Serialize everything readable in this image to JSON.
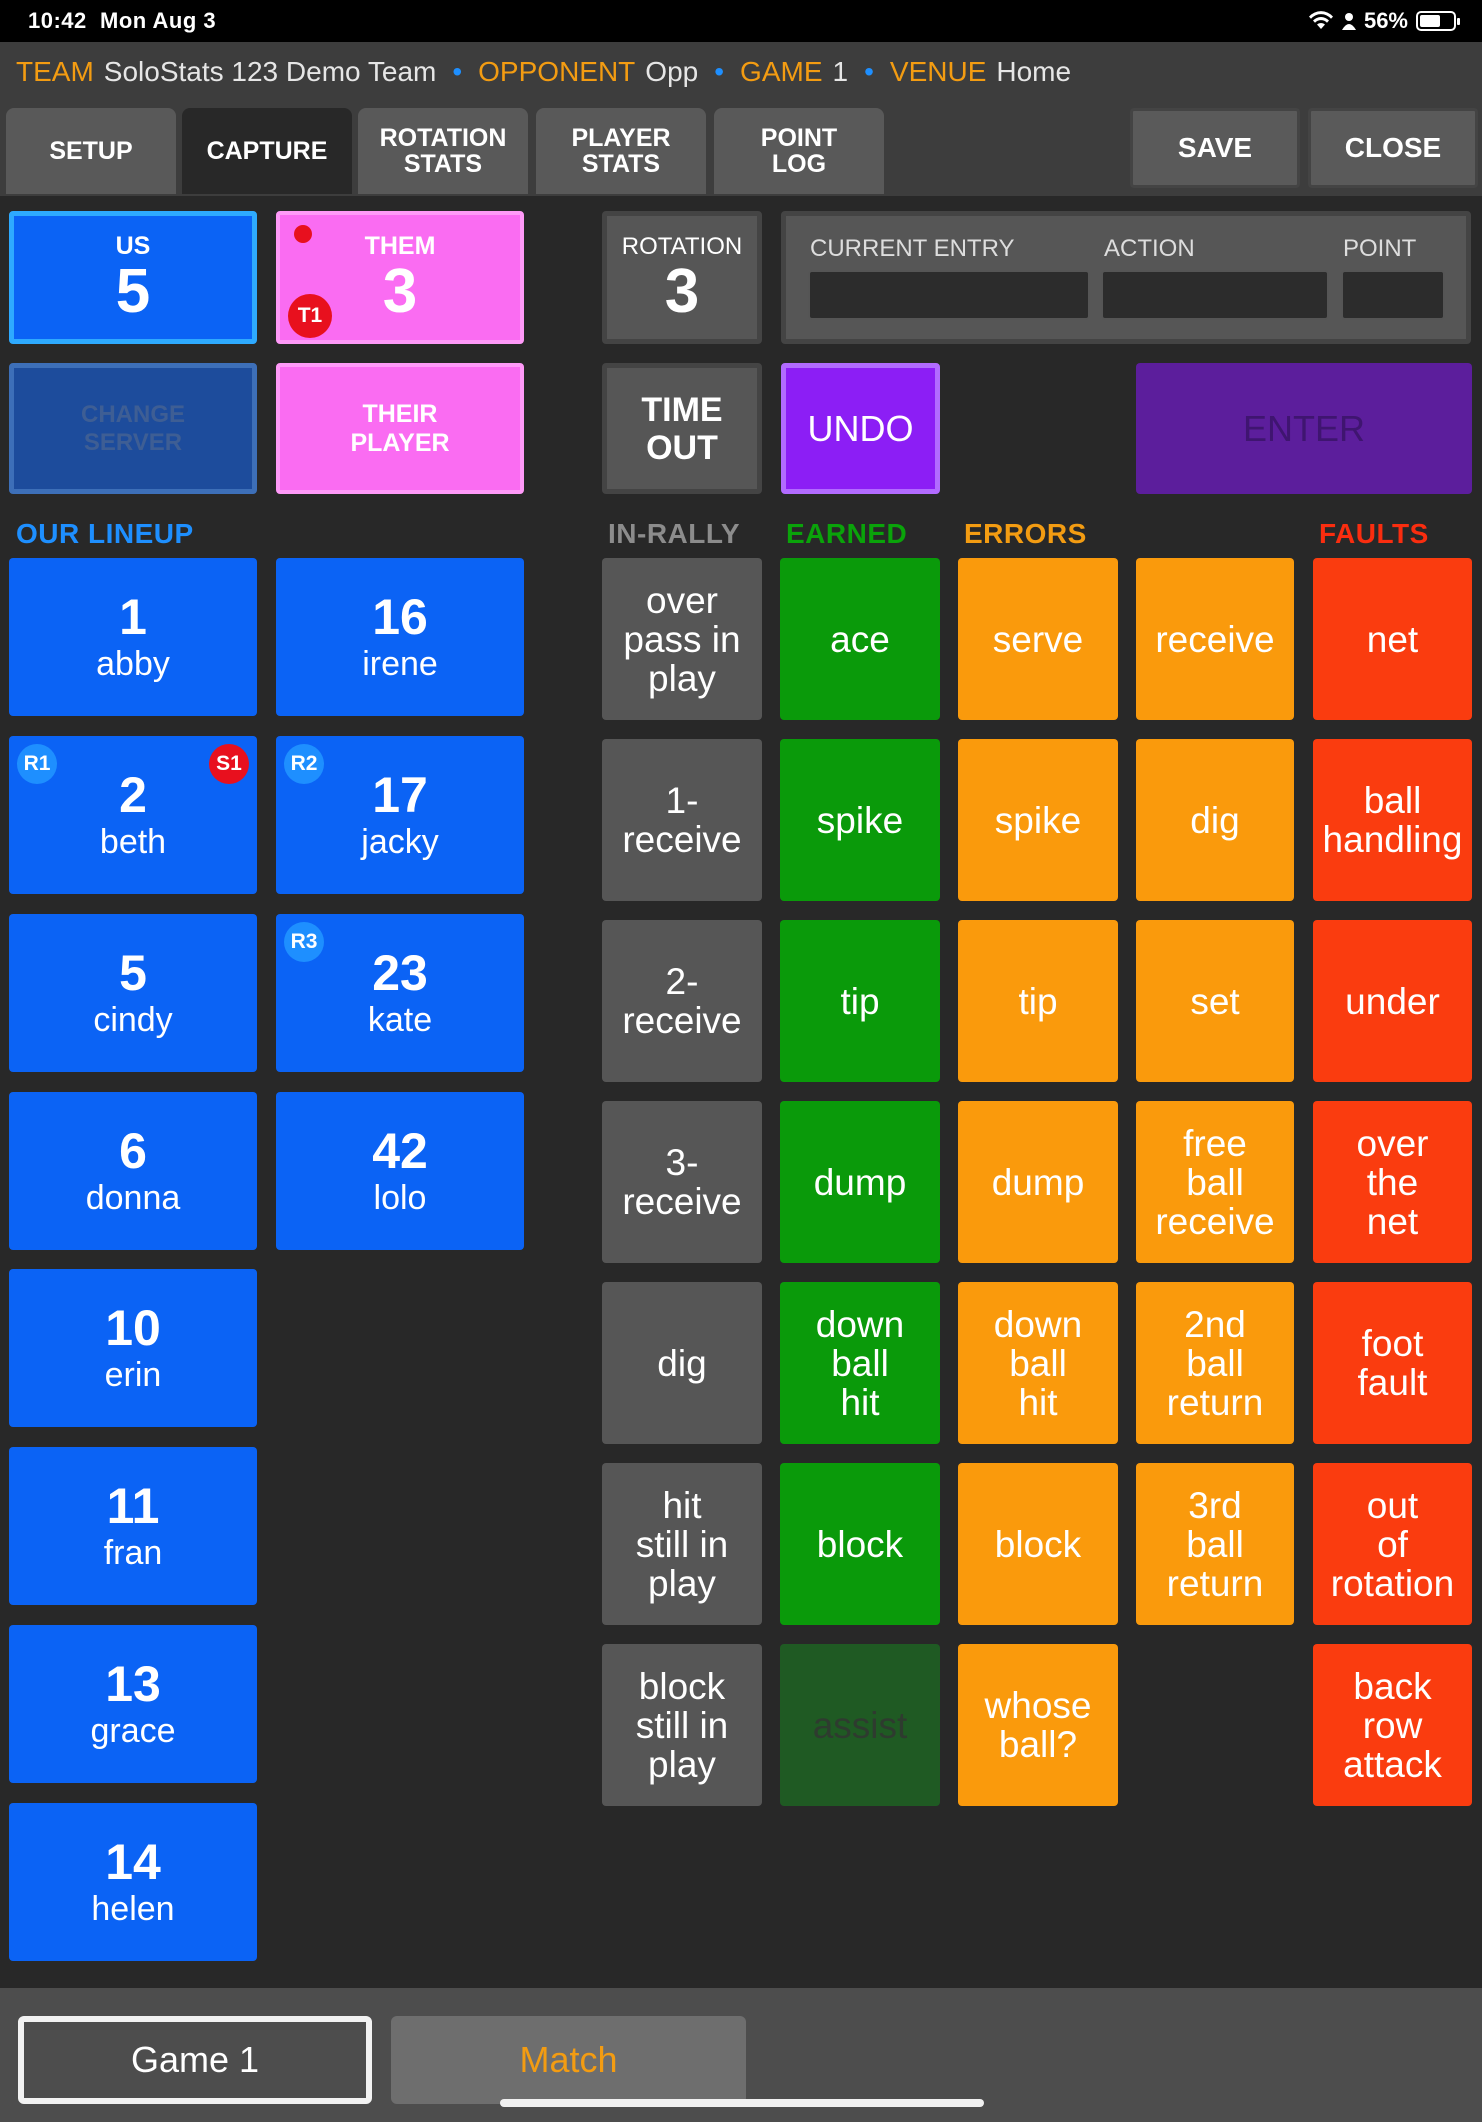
{
  "status": {
    "time": "10:42",
    "date": "Mon Aug 3",
    "battery": "56%",
    "battery_level": 0.56
  },
  "header": {
    "team_label": "TEAM",
    "team": "SoloStats 123 Demo Team",
    "opponent_label": "OPPONENT",
    "opponent": "Opp",
    "game_label": "GAME",
    "game": "1",
    "venue_label": "VENUE",
    "venue": "Home",
    "separator": "•"
  },
  "tabs": {
    "setup": "SETUP",
    "capture": "CAPTURE",
    "rotation_stats": "ROTATION\nSTATS",
    "player_stats": "PLAYER\nSTATS",
    "point_log": "POINT\nLOG",
    "save": "SAVE",
    "close": "CLOSE"
  },
  "score": {
    "us_label": "US",
    "us": "5",
    "them_label": "THEM",
    "them": "3",
    "them_timeout_badge": "T1"
  },
  "buttons": {
    "change_server": "CHANGE\nSERVER",
    "their_player": "THEIR\nPLAYER",
    "time_out": "TIME\nOUT",
    "undo": "UNDO",
    "enter": "ENTER"
  },
  "rotation": {
    "label": "ROTATION",
    "value": "3"
  },
  "entry": {
    "current_entry_label": "CURRENT ENTRY",
    "action_label": "ACTION",
    "point_label": "POINT",
    "current_entry": "",
    "action": "",
    "point": ""
  },
  "sections": {
    "our_lineup": "OUR LINEUP",
    "in_rally": "IN-RALLY",
    "earned": "EARNED",
    "errors": "ERRORS",
    "faults": "FAULTS"
  },
  "lineup": [
    {
      "number": "1",
      "name": "abby"
    },
    {
      "number": "16",
      "name": "irene"
    },
    {
      "number": "2",
      "name": "beth",
      "rotation_badge": "R1",
      "server_badge": "S1"
    },
    {
      "number": "17",
      "name": "jacky",
      "rotation_badge": "R2"
    },
    {
      "number": "5",
      "name": "cindy"
    },
    {
      "number": "23",
      "name": "kate",
      "rotation_badge": "R3"
    },
    {
      "number": "6",
      "name": "donna"
    },
    {
      "number": "42",
      "name": "lolo"
    },
    {
      "number": "10",
      "name": "erin"
    },
    {
      "number": "11",
      "name": "fran"
    },
    {
      "number": "13",
      "name": "grace"
    },
    {
      "number": "14",
      "name": "helen"
    }
  ],
  "in_rally": [
    "over\npass in\nplay",
    "1-\nreceive",
    "2-\nreceive",
    "3-\nreceive",
    "dig",
    "hit\nstill in\nplay",
    "block\nstill in\nplay"
  ],
  "earned": [
    "ace",
    "spike",
    "tip",
    "dump",
    "down\nball\nhit",
    "block",
    "assist"
  ],
  "errors_a": [
    "serve",
    "spike",
    "tip",
    "dump",
    "down\nball\nhit",
    "block",
    "whose\nball?"
  ],
  "errors_b": [
    "receive",
    "dig",
    "set",
    "free\nball\nreceive",
    "2nd\nball\nreturn",
    "3rd\nball\nreturn"
  ],
  "faults": [
    "net",
    "ball\nhandling",
    "under",
    "over\nthe\nnet",
    "foot\nfault",
    "out\nof\nrotation",
    "back\nrow\nattack"
  ],
  "bottom_tabs": {
    "game": "Game 1",
    "match": "Match"
  },
  "colors": {
    "blue": "#0b63f5",
    "pink": "#fa6cf2",
    "green": "#0a9a0a",
    "orange": "#fa9a0c",
    "red": "#fa3c0f",
    "purple_undo": "#8c1ef5",
    "purple_enter": "#5c1e9c",
    "accent_orange": "#f39c12"
  }
}
